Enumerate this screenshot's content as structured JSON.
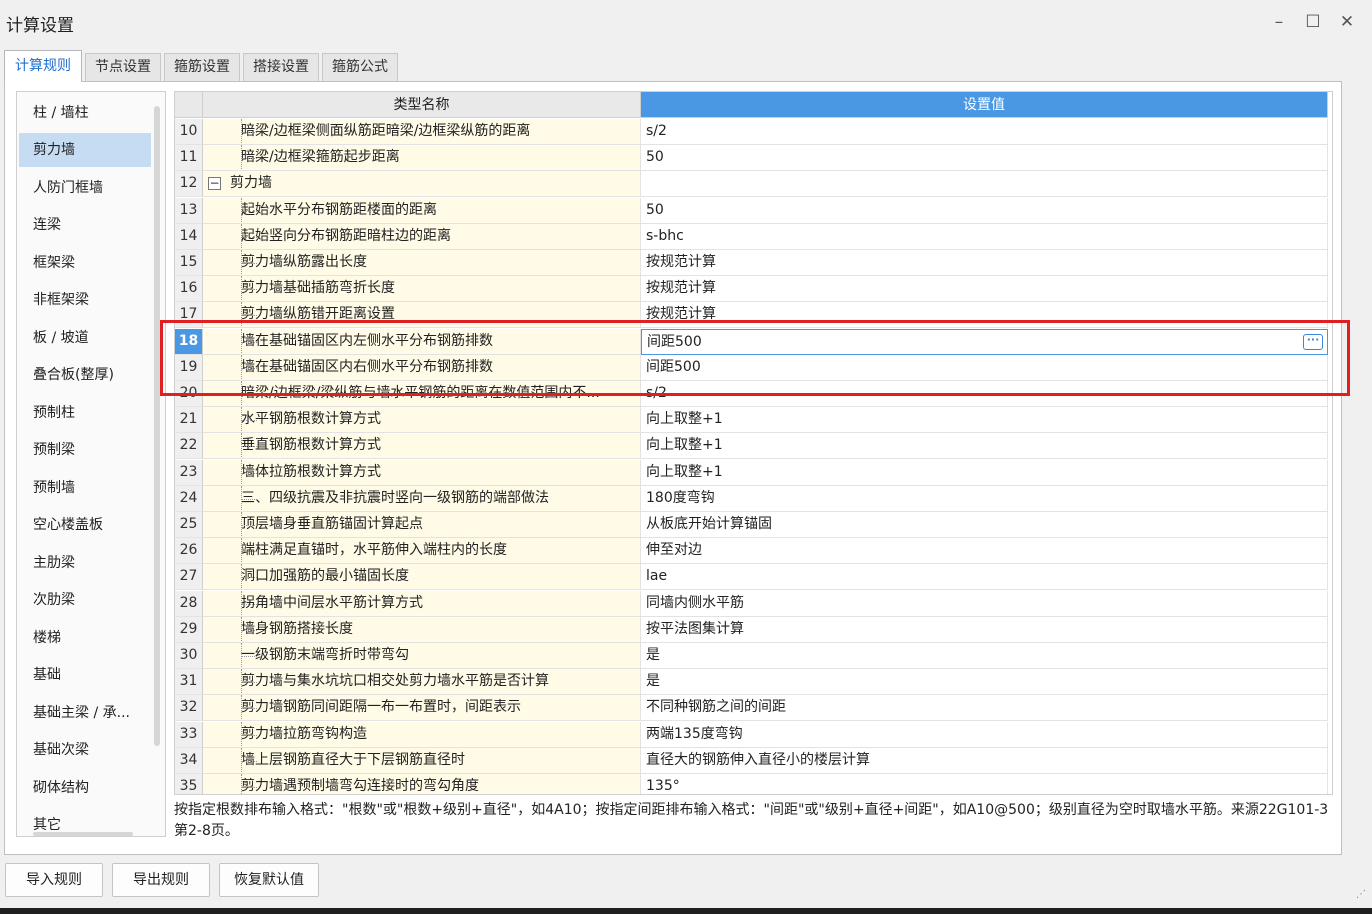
{
  "window": {
    "title": "计算设置",
    "minimize": "–",
    "maximize": "☐",
    "close": "✕"
  },
  "tabs": [
    {
      "label": "计算规则",
      "active": true
    },
    {
      "label": "节点设置"
    },
    {
      "label": "箍筋设置"
    },
    {
      "label": "搭接设置"
    },
    {
      "label": "箍筋公式"
    }
  ],
  "sidebar": {
    "items": [
      {
        "label": "柱 / 墙柱"
      },
      {
        "label": "剪力墙",
        "active": true
      },
      {
        "label": "人防门框墙"
      },
      {
        "label": "连梁"
      },
      {
        "label": "框架梁"
      },
      {
        "label": "非框架梁"
      },
      {
        "label": "板 / 坡道"
      },
      {
        "label": "叠合板(整厚)"
      },
      {
        "label": "预制柱"
      },
      {
        "label": "预制梁"
      },
      {
        "label": "预制墙"
      },
      {
        "label": "空心楼盖板"
      },
      {
        "label": "主肋梁"
      },
      {
        "label": "次肋梁"
      },
      {
        "label": "楼梯"
      },
      {
        "label": "基础"
      },
      {
        "label": "基础主梁 / 承..."
      },
      {
        "label": "基础次梁"
      },
      {
        "label": "砌体结构"
      },
      {
        "label": "其它"
      }
    ]
  },
  "grid": {
    "header": {
      "name": "类型名称",
      "value": "设置值"
    },
    "rows": [
      {
        "no": "10",
        "name": "暗梁/边框梁侧面纵筋距暗梁/边框梁纵筋的距离",
        "value": "s/2"
      },
      {
        "no": "11",
        "name": "暗梁/边框梁箍筋起步距离",
        "value": "50"
      },
      {
        "no": "12",
        "name": "剪力墙",
        "value": "",
        "group": true,
        "collapse": "−"
      },
      {
        "no": "13",
        "name": "起始水平分布钢筋距楼面的距离",
        "value": "50"
      },
      {
        "no": "14",
        "name": "起始竖向分布钢筋距暗柱边的距离",
        "value": "s-bhc"
      },
      {
        "no": "15",
        "name": "剪力墙纵筋露出长度",
        "value": "按规范计算"
      },
      {
        "no": "16",
        "name": "剪力墙基础插筋弯折长度",
        "value": "按规范计算"
      },
      {
        "no": "17",
        "name": "剪力墙纵筋错开距离设置",
        "value": "按规范计算"
      },
      {
        "no": "18",
        "name": "墙在基础锚固区内左侧水平分布钢筋排数",
        "value": "间距500",
        "selected": true,
        "button": "···"
      },
      {
        "no": "19",
        "name": "墙在基础锚固区内右侧水平分布钢筋排数",
        "value": "间距500"
      },
      {
        "no": "20",
        "name": "暗梁/边框梁/梁纵筋与墙水平钢筋的距离在数值范围内不...",
        "value": "s/2"
      },
      {
        "no": "21",
        "name": "水平钢筋根数计算方式",
        "value": "向上取整+1"
      },
      {
        "no": "22",
        "name": "垂直钢筋根数计算方式",
        "value": "向上取整+1"
      },
      {
        "no": "23",
        "name": "墙体拉筋根数计算方式",
        "value": "向上取整+1"
      },
      {
        "no": "24",
        "name": "三、四级抗震及非抗震时竖向一级钢筋的端部做法",
        "value": "180度弯钩"
      },
      {
        "no": "25",
        "name": "顶层墙身垂直筋锚固计算起点",
        "value": "从板底开始计算锚固"
      },
      {
        "no": "26",
        "name": "端柱满足直锚时，水平筋伸入端柱内的长度",
        "value": "伸至对边"
      },
      {
        "no": "27",
        "name": "洞口加强筋的最小锚固长度",
        "value": "lae"
      },
      {
        "no": "28",
        "name": "拐角墙中间层水平筋计算方式",
        "value": "同墙内侧水平筋"
      },
      {
        "no": "29",
        "name": "墙身钢筋搭接长度",
        "value": "按平法图集计算"
      },
      {
        "no": "30",
        "name": "一级钢筋末端弯折时带弯勾",
        "value": "是"
      },
      {
        "no": "31",
        "name": "剪力墙与集水坑坑口相交处剪力墙水平筋是否计算",
        "value": "是"
      },
      {
        "no": "32",
        "name": "剪力墙钢筋同间距隔一布一布置时，间距表示",
        "value": "不同种钢筋之间的间距"
      },
      {
        "no": "33",
        "name": "剪力墙拉筋弯钩构造",
        "value": "两端135度弯钩"
      },
      {
        "no": "34",
        "name": "墙上层钢筋直径大于下层钢筋直径时",
        "value": "直径大的钢筋伸入直径小的楼层计算"
      },
      {
        "no": "35",
        "name": "剪力墙遇预制墙弯勾连接时的弯勾角度",
        "value": "135°"
      }
    ]
  },
  "description": "按指定根数排布输入格式：\"根数\"或\"根数+级别+直径\"，如4A10；按指定间距排布输入格式：\"间距\"或\"级别+直径+间距\"，如A10@500；级别直径为空时取墙水平筋。来源22G101-3第2-8页。",
  "buttons": {
    "import": "导入规则",
    "export": "导出规则",
    "restore": "恢复默认值"
  },
  "colors": {
    "accent": "#4a98e4",
    "highlight_box": "#e02020",
    "tab_active_text": "#1f6fd1"
  }
}
